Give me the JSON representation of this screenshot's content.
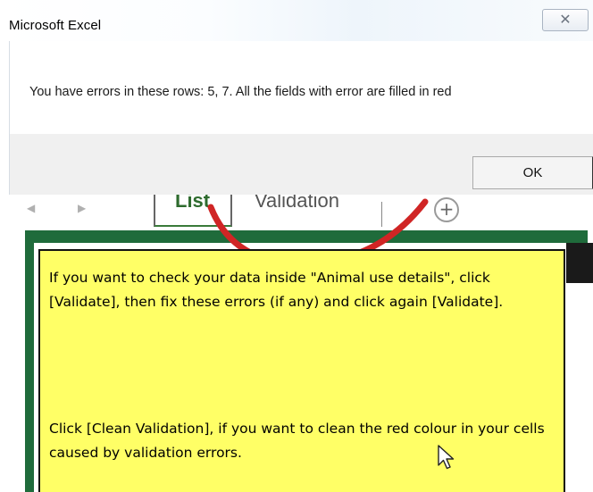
{
  "dialog": {
    "title": "Microsoft Excel",
    "close_label": "✕",
    "message": "You have errors in these rows: 5, 7. All the fields with error are filled in red",
    "ok_label": "OK"
  },
  "sheet_tabs": {
    "items": [
      {
        "label": "List",
        "active": true
      },
      {
        "label": "Validation",
        "active": false
      }
    ],
    "add_label": "+"
  },
  "note": {
    "paragraph1": "If you want to check your data inside \"Animal use details\", click [Validate], then fix these errors (if any) and click again [Validate].",
    "paragraph2": "Click [Clean Validation], if you want to clean the red colour in your cells caused by validation errors."
  },
  "colors": {
    "excel_green": "#1f6b3b",
    "note_yellow": "#ffff66",
    "annotation_red": "#d02525"
  },
  "icons": {
    "close": "close-icon",
    "nav_prev": "chevron-left-icon",
    "nav_next": "chevron-right-icon",
    "add_sheet": "plus-circle-icon",
    "cursor": "mouse-pointer-icon"
  }
}
